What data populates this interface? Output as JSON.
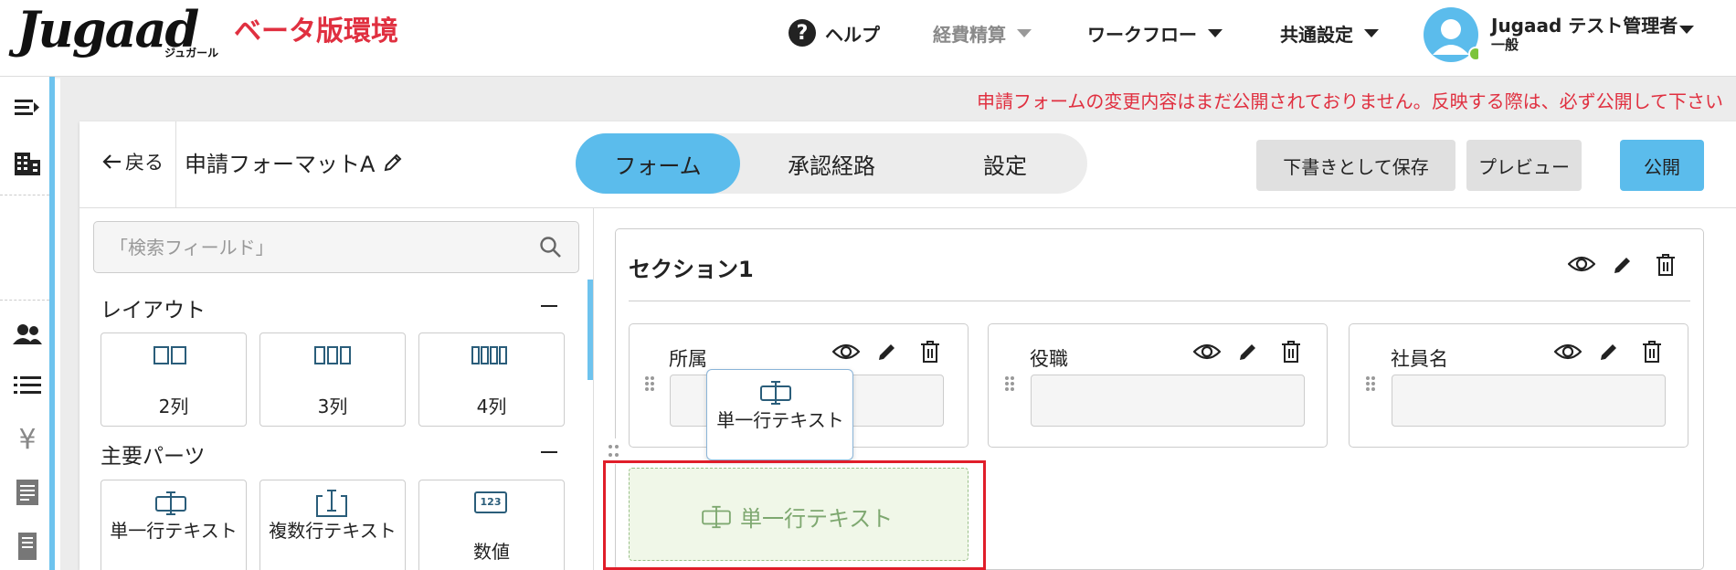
{
  "header": {
    "logo_text": "Jugaad",
    "logo_sub": "ジュガール",
    "env_label": "ベータ版環境",
    "nav": [
      {
        "label": "ヘルプ",
        "icon": "help-icon"
      },
      {
        "label": "経費精算",
        "disabled": true
      },
      {
        "label": "ワークフロー"
      },
      {
        "label": "共通設定"
      }
    ],
    "user": {
      "name": "Jugaad テスト管理者",
      "role": "一般",
      "status_color": "#7cc43a"
    }
  },
  "sidebar": {
    "icons": [
      "menu-collapse-icon",
      "building-icon",
      "users-icon",
      "list-icon",
      "yen-icon",
      "document-icon",
      "receipt-icon"
    ]
  },
  "notice": "申請フォームの変更内容はまだ公開されておりません。反映する際は、必ず公開して下さい",
  "toolbar": {
    "back_label": "戻る",
    "form_name": "申請フォーマットA",
    "tabs": [
      "フォーム",
      "承認経路",
      "設定"
    ],
    "active_tab": "フォーム",
    "save_draft_label": "下書きとして保存",
    "preview_label": "プレビュー",
    "publish_label": "公開"
  },
  "palette": {
    "search_placeholder": "「検索フィールド」",
    "layout_header": "レイアウト",
    "layout_items": [
      "2列",
      "3列",
      "4列"
    ],
    "parts_header": "主要パーツ",
    "parts_items": [
      "単一行テキスト",
      "複数行テキスト",
      "数値"
    ],
    "parts_icon_number": "123"
  },
  "canvas": {
    "section_title": "セクション1",
    "fields": [
      "所属",
      "役職",
      "社員名"
    ],
    "drag_ghost_label": "単一行テキスト",
    "drop_label": "単一行テキスト"
  },
  "colors": {
    "accent": "#5bbcec",
    "brand_red": "#e03040",
    "highlight": "#e01e2a"
  }
}
